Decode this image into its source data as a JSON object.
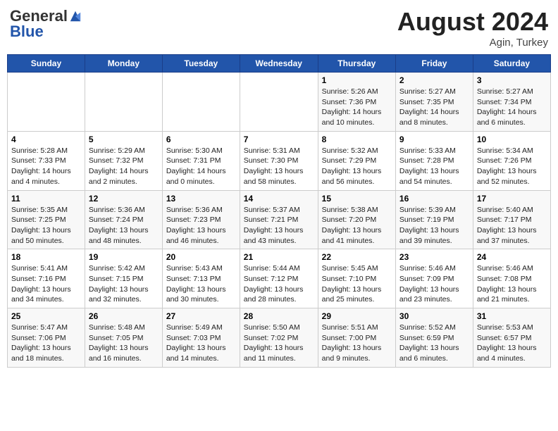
{
  "header": {
    "logo_general": "General",
    "logo_blue": "Blue",
    "month_year": "August 2024",
    "location": "Agin, Turkey"
  },
  "weekdays": [
    "Sunday",
    "Monday",
    "Tuesday",
    "Wednesday",
    "Thursday",
    "Friday",
    "Saturday"
  ],
  "weeks": [
    [
      {
        "day": "",
        "info": ""
      },
      {
        "day": "",
        "info": ""
      },
      {
        "day": "",
        "info": ""
      },
      {
        "day": "",
        "info": ""
      },
      {
        "day": "1",
        "info": "Sunrise: 5:26 AM\nSunset: 7:36 PM\nDaylight: 14 hours\nand 10 minutes."
      },
      {
        "day": "2",
        "info": "Sunrise: 5:27 AM\nSunset: 7:35 PM\nDaylight: 14 hours\nand 8 minutes."
      },
      {
        "day": "3",
        "info": "Sunrise: 5:27 AM\nSunset: 7:34 PM\nDaylight: 14 hours\nand 6 minutes."
      }
    ],
    [
      {
        "day": "4",
        "info": "Sunrise: 5:28 AM\nSunset: 7:33 PM\nDaylight: 14 hours\nand 4 minutes."
      },
      {
        "day": "5",
        "info": "Sunrise: 5:29 AM\nSunset: 7:32 PM\nDaylight: 14 hours\nand 2 minutes."
      },
      {
        "day": "6",
        "info": "Sunrise: 5:30 AM\nSunset: 7:31 PM\nDaylight: 14 hours\nand 0 minutes."
      },
      {
        "day": "7",
        "info": "Sunrise: 5:31 AM\nSunset: 7:30 PM\nDaylight: 13 hours\nand 58 minutes."
      },
      {
        "day": "8",
        "info": "Sunrise: 5:32 AM\nSunset: 7:29 PM\nDaylight: 13 hours\nand 56 minutes."
      },
      {
        "day": "9",
        "info": "Sunrise: 5:33 AM\nSunset: 7:28 PM\nDaylight: 13 hours\nand 54 minutes."
      },
      {
        "day": "10",
        "info": "Sunrise: 5:34 AM\nSunset: 7:26 PM\nDaylight: 13 hours\nand 52 minutes."
      }
    ],
    [
      {
        "day": "11",
        "info": "Sunrise: 5:35 AM\nSunset: 7:25 PM\nDaylight: 13 hours\nand 50 minutes."
      },
      {
        "day": "12",
        "info": "Sunrise: 5:36 AM\nSunset: 7:24 PM\nDaylight: 13 hours\nand 48 minutes."
      },
      {
        "day": "13",
        "info": "Sunrise: 5:36 AM\nSunset: 7:23 PM\nDaylight: 13 hours\nand 46 minutes."
      },
      {
        "day": "14",
        "info": "Sunrise: 5:37 AM\nSunset: 7:21 PM\nDaylight: 13 hours\nand 43 minutes."
      },
      {
        "day": "15",
        "info": "Sunrise: 5:38 AM\nSunset: 7:20 PM\nDaylight: 13 hours\nand 41 minutes."
      },
      {
        "day": "16",
        "info": "Sunrise: 5:39 AM\nSunset: 7:19 PM\nDaylight: 13 hours\nand 39 minutes."
      },
      {
        "day": "17",
        "info": "Sunrise: 5:40 AM\nSunset: 7:17 PM\nDaylight: 13 hours\nand 37 minutes."
      }
    ],
    [
      {
        "day": "18",
        "info": "Sunrise: 5:41 AM\nSunset: 7:16 PM\nDaylight: 13 hours\nand 34 minutes."
      },
      {
        "day": "19",
        "info": "Sunrise: 5:42 AM\nSunset: 7:15 PM\nDaylight: 13 hours\nand 32 minutes."
      },
      {
        "day": "20",
        "info": "Sunrise: 5:43 AM\nSunset: 7:13 PM\nDaylight: 13 hours\nand 30 minutes."
      },
      {
        "day": "21",
        "info": "Sunrise: 5:44 AM\nSunset: 7:12 PM\nDaylight: 13 hours\nand 28 minutes."
      },
      {
        "day": "22",
        "info": "Sunrise: 5:45 AM\nSunset: 7:10 PM\nDaylight: 13 hours\nand 25 minutes."
      },
      {
        "day": "23",
        "info": "Sunrise: 5:46 AM\nSunset: 7:09 PM\nDaylight: 13 hours\nand 23 minutes."
      },
      {
        "day": "24",
        "info": "Sunrise: 5:46 AM\nSunset: 7:08 PM\nDaylight: 13 hours\nand 21 minutes."
      }
    ],
    [
      {
        "day": "25",
        "info": "Sunrise: 5:47 AM\nSunset: 7:06 PM\nDaylight: 13 hours\nand 18 minutes."
      },
      {
        "day": "26",
        "info": "Sunrise: 5:48 AM\nSunset: 7:05 PM\nDaylight: 13 hours\nand 16 minutes."
      },
      {
        "day": "27",
        "info": "Sunrise: 5:49 AM\nSunset: 7:03 PM\nDaylight: 13 hours\nand 14 minutes."
      },
      {
        "day": "28",
        "info": "Sunrise: 5:50 AM\nSunset: 7:02 PM\nDaylight: 13 hours\nand 11 minutes."
      },
      {
        "day": "29",
        "info": "Sunrise: 5:51 AM\nSunset: 7:00 PM\nDaylight: 13 hours\nand 9 minutes."
      },
      {
        "day": "30",
        "info": "Sunrise: 5:52 AM\nSunset: 6:59 PM\nDaylight: 13 hours\nand 6 minutes."
      },
      {
        "day": "31",
        "info": "Sunrise: 5:53 AM\nSunset: 6:57 PM\nDaylight: 13 hours\nand 4 minutes."
      }
    ]
  ]
}
